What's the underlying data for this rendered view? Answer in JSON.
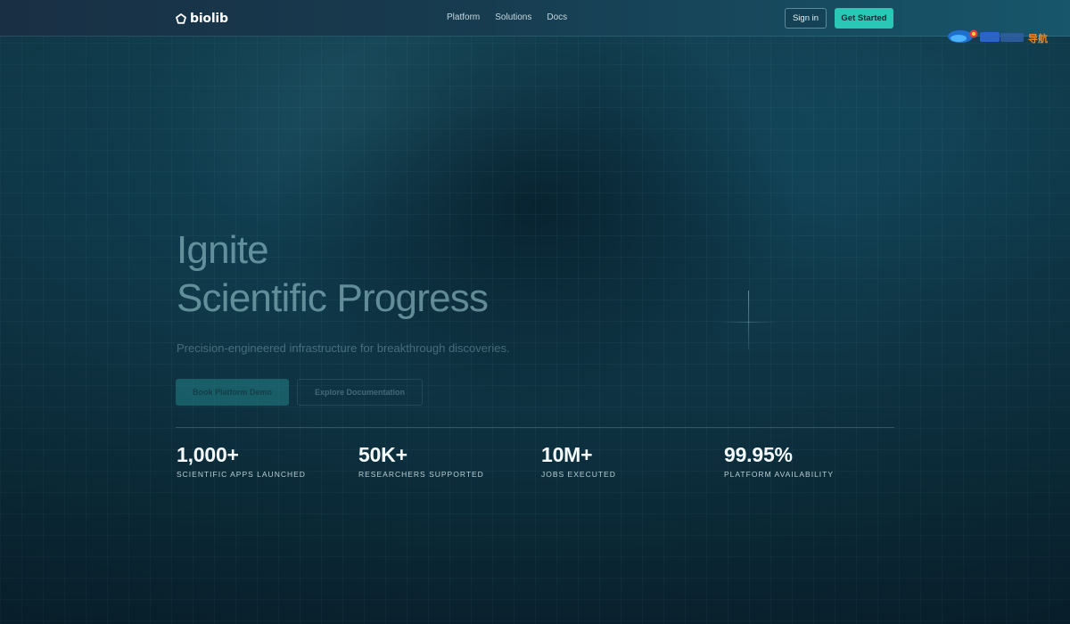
{
  "header": {
    "logo_text": "biolib",
    "nav": [
      "Platform",
      "Solutions",
      "Docs"
    ],
    "signin_label": "Sign in",
    "get_started_label": "Get Started"
  },
  "hero": {
    "title_line1": "Ignite",
    "title_line2": "Scientific Progress",
    "subtitle": "Precision-engineered infrastructure for breakthrough discoveries.",
    "primary_cta": "Book Platform Demo",
    "secondary_cta": "Explore Documentation"
  },
  "stats": [
    {
      "value": "1,000+",
      "label": "SCIENTIFIC APPS LAUNCHED"
    },
    {
      "value": "50K+",
      "label": "RESEARCHERS SUPPORTED"
    },
    {
      "value": "10M+",
      "label": "JOBS EXECUTED"
    },
    {
      "value": "99.95%",
      "label": "PLATFORM AVAILABILITY"
    }
  ],
  "colors": {
    "accent": "#2bc7b6",
    "background": "#0f3646",
    "header": "#173c50"
  },
  "icons": {
    "logo": "pentagon-logo-icon",
    "watermark": "watermark-logo"
  },
  "watermark_text": "导航"
}
